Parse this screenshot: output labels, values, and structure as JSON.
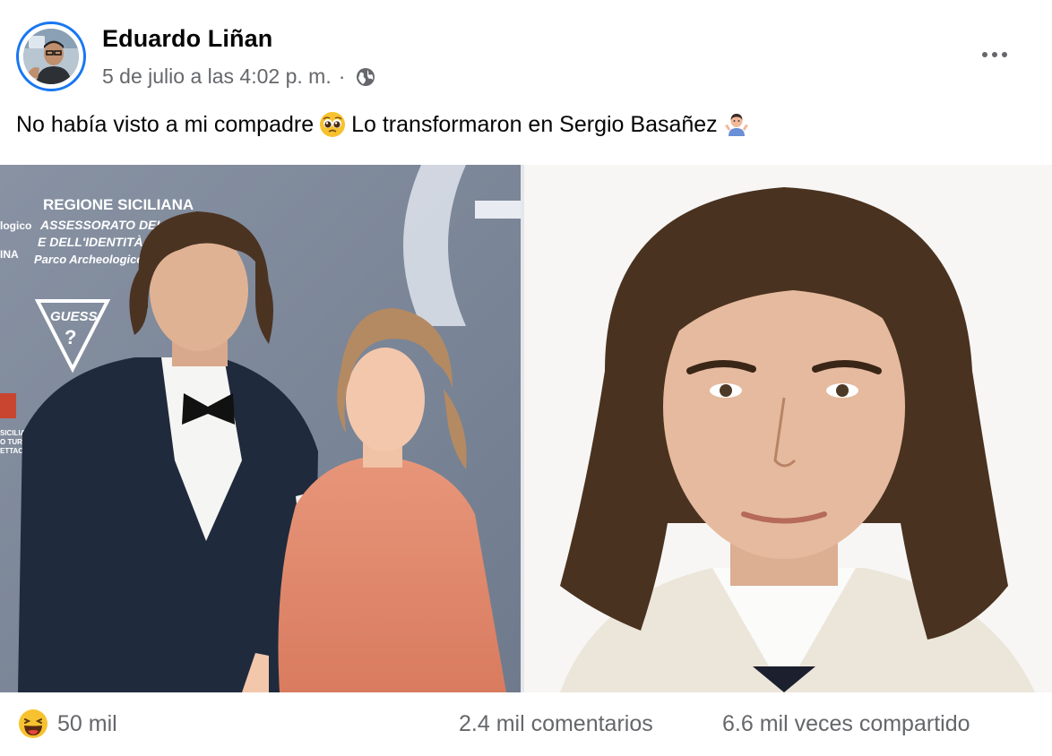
{
  "post": {
    "author": "Eduardo Liñan",
    "timestamp": "5 de julio a las 4:02 p. m.",
    "separator": "·",
    "privacy_icon": "globe-icon",
    "more_icon": "more-options-icon",
    "text_part1": "No había visto a mi compadre",
    "emoji1": "pleading-face-emoji",
    "text_part2": "Lo transformaron en Sergio Basañez",
    "emoji2": "person-shrugging-emoji"
  },
  "photos": {
    "left": {
      "backdrop_lines": [
        "REGIONE SICILIANA",
        "ASSESSORATO DEI BENI",
        "E DELL'IDENTITÀ SI",
        "Parco Archeologico"
      ],
      "side_lines": [
        "logico",
        "INA"
      ],
      "guess_label": "GUESS",
      "guess_mark": "?",
      "bottom_lines": [
        "SICILIANA",
        "O TURISMO,",
        "ETTACOLO"
      ]
    }
  },
  "footer": {
    "reaction_icon": "laughing-emoji",
    "reaction_count": "50 mil",
    "comments": "2.4 mil comentarios",
    "shares": "6.6 mil veces compartido"
  },
  "colors": {
    "accent": "#1877f2",
    "secondary_text": "#65676b",
    "primary_text": "#050505"
  }
}
